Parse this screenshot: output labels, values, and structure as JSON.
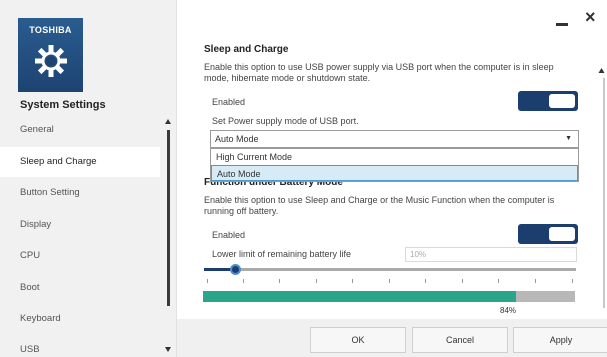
{
  "brand": "TOSHIBA",
  "sidebar": {
    "heading": "System Settings",
    "items": [
      {
        "label": "General"
      },
      {
        "label": "Sleep and Charge"
      },
      {
        "label": "Button Setting"
      },
      {
        "label": "Display"
      },
      {
        "label": "CPU"
      },
      {
        "label": "Boot"
      },
      {
        "label": "Keyboard"
      },
      {
        "label": "USB"
      }
    ],
    "active_index": 1
  },
  "window": {
    "minimize_icon": "minimize-icon",
    "close_symbol": "×"
  },
  "sleep_and_charge": {
    "title": "Sleep and Charge",
    "description": "Enable this option to use USB power supply via USB port when the computer is in sleep mode, hibernate mode or shutdown state.",
    "enabled_label": "Enabled",
    "enabled": true,
    "mode_label": "Set Power supply mode of USB port.",
    "mode_value": "Auto Mode",
    "mode_options": [
      "High Current Mode",
      "Auto Mode"
    ],
    "highlighted_option": "Auto Mode"
  },
  "battery_mode": {
    "title_partial": "Function under Battery Mode",
    "description": "Enable this option to use Sleep and Charge or the Music Function when the computer is running off battery.",
    "enabled_label": "Enabled",
    "enabled": true,
    "limit_label": "Lower limit of remaining battery life",
    "limit_value": "10%",
    "slider_fraction": 0.1,
    "battery_level_label": "84%",
    "battery_level_fraction": 0.84
  },
  "buttons": {
    "ok": "OK",
    "cancel": "Cancel",
    "apply": "Apply"
  },
  "colors": {
    "accent": "#1c3e6e",
    "battery_fill": "#2aa58a",
    "logo_bg": "#2a5c8f"
  }
}
